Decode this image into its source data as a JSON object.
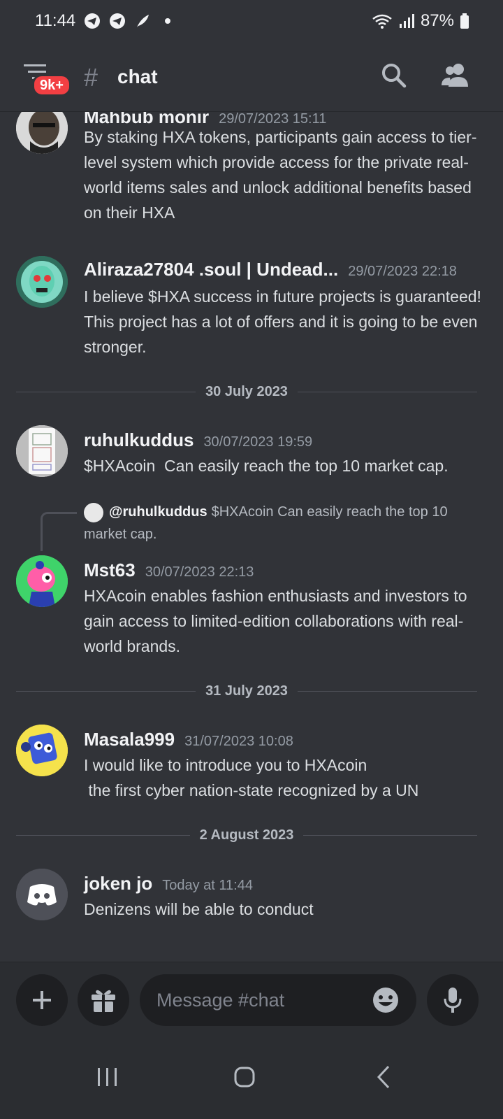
{
  "status": {
    "time": "11:44",
    "battery": "87%"
  },
  "header": {
    "badge": "9k+",
    "hash": "#",
    "channel": "chat"
  },
  "messages": [
    {
      "author": "Mahbub monir",
      "time": "29/07/2023 15:11",
      "text": "By staking HXA tokens, participants gain access to tier-level system which provide access for the private real-world items sales and unlock additional benefits based on their HXA"
    },
    {
      "author": "Aliraza27804 .soul | Undead...",
      "time": "29/07/2023 22:18",
      "text": "I believe $HXA success in future projects is guaranteed!  This project has a lot of offers and it is going to be even stronger."
    },
    {
      "author": "ruhulkuddus",
      "time": "30/07/2023 19:59",
      "text": "$HXAcoin  Can easily reach the top 10 market cap."
    },
    {
      "author": "Mst63",
      "time": "30/07/2023 22:13",
      "text": "HXAcoin enables fashion enthusiasts and investors to gain access to limited-edition collaborations with real-world brands."
    },
    {
      "author": "Masala999",
      "time": "31/07/2023 10:08",
      "text": "I would like to introduce you to HXAcoin\n the first cyber nation-state recognized by a UN"
    },
    {
      "author": "joken  jo",
      "time": "Today at 11:44",
      "text": "Denizens will be able to conduct"
    }
  ],
  "reply": {
    "author": "@ruhulkuddus",
    "text": "$HXAcoin  Can easily reach the top 10 market cap."
  },
  "dividers": [
    "30 July 2023",
    "31 July 2023",
    "2 August 2023"
  ],
  "input": {
    "placeholder": "Message #chat"
  },
  "colors": {
    "background": "#313338",
    "badge": "#f23f43",
    "input_bg": "#1e1f22"
  }
}
